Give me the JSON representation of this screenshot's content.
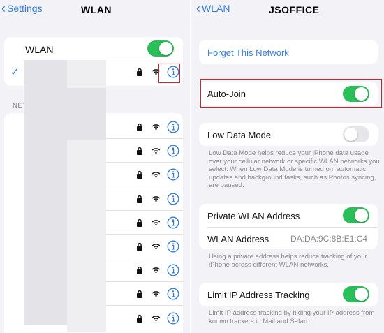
{
  "left": {
    "back_label": "Settings",
    "title": "WLAN",
    "wlan_label": "WLAN",
    "wlan_on": true,
    "connected_checkmark": "✓",
    "section_header": "NET",
    "network_rows": 9
  },
  "right": {
    "back_label": "WLAN",
    "title": "JSOFFICE",
    "forget": "Forget This Network",
    "auto_join": "Auto-Join",
    "auto_join_on": true,
    "low_data_mode": "Low Data Mode",
    "low_data_mode_on": false,
    "low_data_note": "Low Data Mode helps reduce your iPhone data usage over your cellular network or specific WLAN networks you select. When Low Data Mode is turned on, automatic updates and background tasks, such as Photos syncing, are paused.",
    "private_address": "Private WLAN Address",
    "private_address_on": true,
    "wlan_address_label": "WLAN Address",
    "wlan_address_value": "DA:DA:9C:8B:E1:C4",
    "private_note": "Using a private address helps reduce tracking of your iPhone across different WLAN networks.",
    "limit_ip": "Limit IP Address Tracking",
    "limit_ip_on": true,
    "limit_note": "Limit IP address tracking by hiding your IP address from known trackers in Mail and Safari."
  },
  "colors": {
    "accent": "#2f7ce6",
    "toggle_on": "#2bbf5a",
    "highlight": "#d8202a"
  }
}
